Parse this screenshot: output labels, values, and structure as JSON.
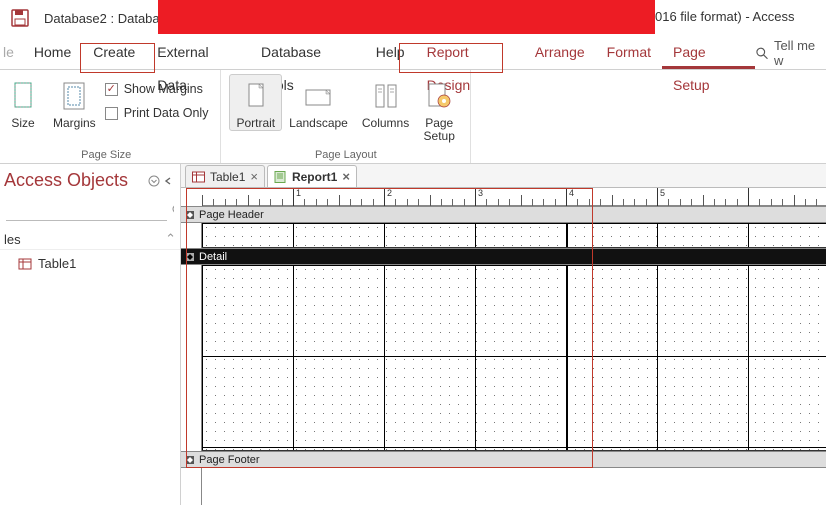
{
  "title": {
    "left": "Database2 : Database",
    "right": "016 file format)  -  Access"
  },
  "tabs": {
    "file_ghost": "le",
    "home": "Home",
    "create": "Create",
    "external": "External Data",
    "dbtools": "Database Tools",
    "help": "Help",
    "report_design": "Report Design",
    "arrange": "Arrange",
    "format": "Format",
    "page_setup": "Page Setup",
    "tell_me": "Tell me w"
  },
  "ribbon": {
    "size": "Size",
    "margins": "Margins",
    "show_margins": "Show Margins",
    "print_data_only": "Print Data Only",
    "portrait": "Portrait",
    "landscape": "Landscape",
    "columns": "Columns",
    "page_setup": "Page\nSetup",
    "group_page_size": "Page Size",
    "group_page_layout": "Page Layout"
  },
  "nav": {
    "title": "Access Objects",
    "search_placeholder": "",
    "section": "les",
    "items": [
      "Table1"
    ]
  },
  "docs": {
    "table1": "Table1",
    "report1": "Report1"
  },
  "sections": {
    "page_header": "Page Header",
    "detail": "Detail",
    "page_footer": "Page Footer"
  },
  "ruler": {
    "marks": [
      1,
      2,
      3,
      4,
      5
    ]
  }
}
